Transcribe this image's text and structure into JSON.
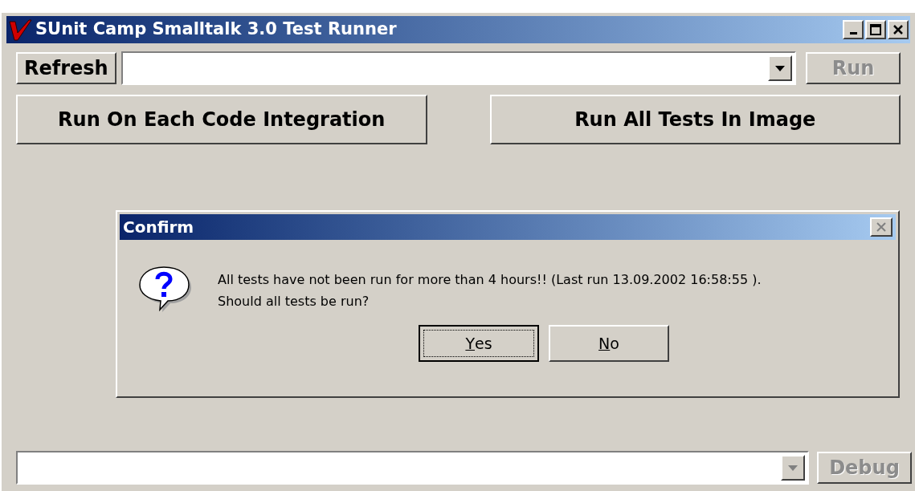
{
  "window": {
    "title": "SUnit Camp Smalltalk 3.0 Test Runner"
  },
  "toolbar": {
    "refresh": {
      "label": "Refresh",
      "disabled": false
    },
    "test_combo": {
      "disabled": false
    },
    "run": {
      "label": "Run",
      "disabled": true
    }
  },
  "actions": [
    {
      "label": "Run On Each Code Integration"
    },
    {
      "label": "Run All Tests In Image"
    }
  ],
  "dialog": {
    "title": "Confirm",
    "message_lines": [
      "All tests have not been run for more than 4 hours!! (Last run 13.09.2002 16:58:55 ).",
      "Should all tests be run?"
    ],
    "buttons": [
      {
        "label": "Yes",
        "focused": true,
        "mnemonic_first": true
      },
      {
        "label": "No",
        "focused": false,
        "mnemonic_first": true
      }
    ]
  },
  "bottom": {
    "result_combo": {
      "disabled": true
    },
    "debug": {
      "label": "Debug",
      "disabled": true
    }
  }
}
